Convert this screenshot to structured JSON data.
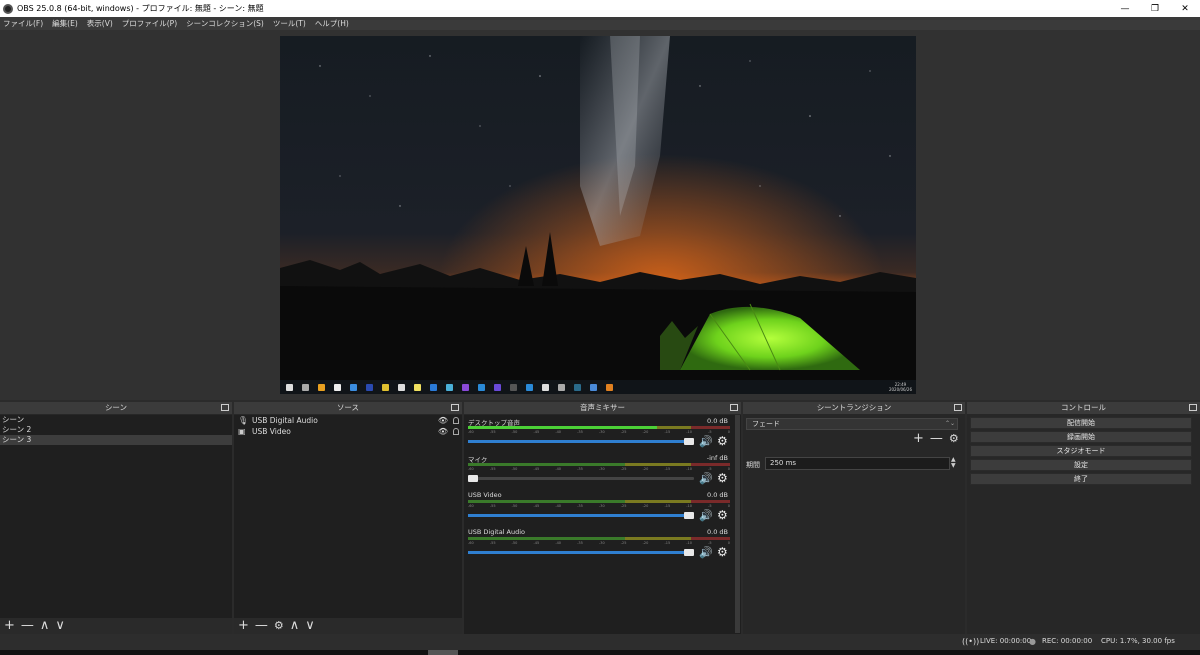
{
  "window": {
    "title": "OBS 25.0.8 (64-bit, windows) - プロファイル: 無題 - シーン: 無題",
    "minimize": "—",
    "maximize": "❐",
    "close": "✕"
  },
  "menu": [
    "ファイル(F)",
    "編集(E)",
    "表示(V)",
    "プロファイル(P)",
    "シーンコレクション(S)",
    "ツール(T)",
    "ヘルプ(H)"
  ],
  "preview": {
    "clock": "22:49\n2020/06/26"
  },
  "scenes": {
    "header": "シーン",
    "items": [
      "シーン",
      "シーン 2",
      "シーン 3"
    ],
    "selected_index": 2,
    "footer": [
      "+",
      "—",
      "∧",
      "∨"
    ]
  },
  "sources": {
    "header": "ソース",
    "items": [
      {
        "icon": "microphone-icon",
        "label": "USB Digital Audio"
      },
      {
        "icon": "camera-icon",
        "label": "USB Video"
      }
    ],
    "footer": [
      "+",
      "—",
      "⚙",
      "∧",
      "∨"
    ]
  },
  "mixer": {
    "header": "音声ミキサー",
    "ticks": [
      "-60",
      "-55",
      "-50",
      "-45",
      "-40",
      "-35",
      "-30",
      "-25",
      "-20",
      "-15",
      "-10",
      "-5",
      "0"
    ],
    "channels": [
      {
        "name": "デスクトップ音声",
        "db": "0.0 dB",
        "level": 0.72,
        "fader": 1.0
      },
      {
        "name": "マイク",
        "db": "-inf dB",
        "level": 0,
        "fader": 0.0
      },
      {
        "name": "USB Video",
        "db": "0.0 dB",
        "level": 0,
        "fader": 1.0
      },
      {
        "name": "USB Digital Audio",
        "db": "0.0 dB",
        "level": 0,
        "fader": 1.0
      }
    ]
  },
  "transitions": {
    "header": "シーントランジション",
    "selected": "フェード",
    "duration_label": "期間",
    "duration_value": "250 ms"
  },
  "controls": {
    "header": "コントロール",
    "buttons": [
      "配信開始",
      "録画開始",
      "スタジオモード",
      "設定",
      "終了"
    ]
  },
  "status": {
    "live": "LIVE: 00:00:00",
    "rec": "REC: 00:00:00",
    "cpu": "CPU: 1.7%, 30.00 fps"
  },
  "colors": {
    "accent": "#2f7fd0",
    "meter_green": "#4cd137",
    "tent": "#7ed321"
  }
}
